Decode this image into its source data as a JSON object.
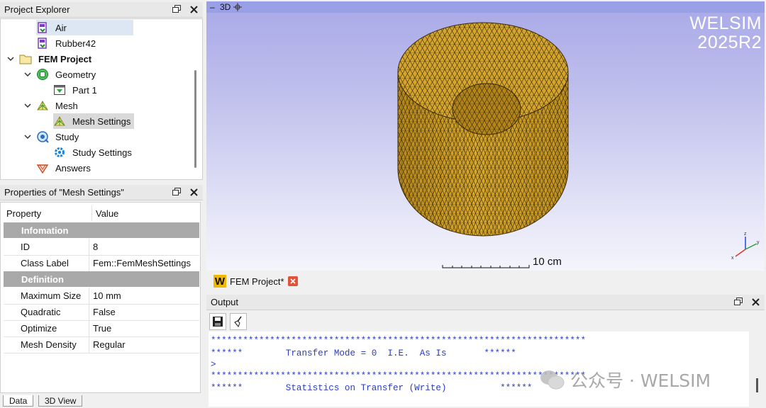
{
  "project_explorer": {
    "title": "Project Explorer",
    "items": [
      {
        "label": "Air",
        "icon": "material-icon"
      },
      {
        "label": "Rubber42",
        "icon": "material-icon"
      },
      {
        "label": "FEM Project",
        "icon": "folder-icon"
      },
      {
        "label": "Geometry",
        "icon": "geometry-icon"
      },
      {
        "label": "Part 1",
        "icon": "part-icon"
      },
      {
        "label": "Mesh",
        "icon": "mesh-icon"
      },
      {
        "label": "Mesh Settings",
        "icon": "mesh-settings-icon"
      },
      {
        "label": "Study",
        "icon": "study-icon"
      },
      {
        "label": "Study Settings",
        "icon": "gear-icon"
      },
      {
        "label": "Answers",
        "icon": "answers-icon"
      }
    ]
  },
  "properties": {
    "title": "Properties of \"Mesh Settings\"",
    "col_property": "Property",
    "col_value": "Value",
    "groups": [
      {
        "name": "Infomation",
        "rows": [
          {
            "key": "ID",
            "value": "8"
          },
          {
            "key": "Class Label",
            "value": "Fem::FemMeshSettings"
          }
        ]
      },
      {
        "name": "Definition",
        "rows": [
          {
            "key": "Maximum Size",
            "value": "10 mm"
          },
          {
            "key": "Quadratic",
            "value": "False"
          },
          {
            "key": "Optimize",
            "value": "True"
          },
          {
            "key": "Mesh Density",
            "value": "Regular"
          }
        ]
      }
    ]
  },
  "bottom_tabs": {
    "data": "Data",
    "view3d": "3D View"
  },
  "viewport": {
    "label": "3D",
    "brand_line1": "WELSIM",
    "brand_line2": "2025R2",
    "scale_label": "10 cm",
    "mesh_color": "#d4a52a"
  },
  "doc_tab": {
    "label": "FEM Project*",
    "icon_letter": "W"
  },
  "output": {
    "title": "Output",
    "lines": [
      "˜",
      "**********************************************************************",
      "******        Transfer Mode = 0  I.E.  As Is       ******",
      ">",
      "**********************************************************************",
      "******        Statistics on Transfer (Write)          ******"
    ],
    "watermark": "公众号 · WELSIM"
  }
}
